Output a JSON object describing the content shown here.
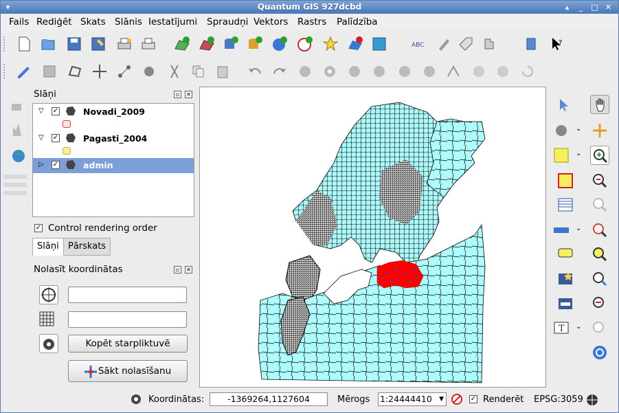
{
  "window": {
    "title": "Quantum GIS 927dcbd"
  },
  "menubar": [
    "Fails",
    "Rediģēt",
    "Skats",
    "Slānis",
    "Iestatījumi",
    "Spraudņi",
    "Vektors",
    "Rastrs",
    "Palīdzība"
  ],
  "layers_panel": {
    "title": "Slāņi",
    "layers": [
      {
        "name": "Novadi_2009",
        "checked": true,
        "expanded": true,
        "legend_color": "#f4c4c4"
      },
      {
        "name": "Pagasti_2004",
        "checked": true,
        "expanded": true,
        "legend_color": "#f5ef9a"
      },
      {
        "name": "admin",
        "checked": true,
        "expanded": false,
        "selected": true
      }
    ],
    "control_rendering_order": "Control rendering order",
    "tabs": [
      "Slāņi",
      "Pārskats"
    ]
  },
  "coordinate_panel": {
    "title": "Nolasīt koordinātas",
    "copy_button": "Kopēt starpliktuvē",
    "start_button": "Sākt nolasīšanu"
  },
  "map": {
    "land_color": "#aefcfc",
    "highlight_color": "#ff0000"
  },
  "statusbar": {
    "coordinates_label": "Koordinātas:",
    "coordinates_value": "-1369264,1127604",
    "scale_label": "Mērogs",
    "scale_value": "1:24444410",
    "render_label": "Renderēt",
    "epsg": "EPSG:3059"
  }
}
